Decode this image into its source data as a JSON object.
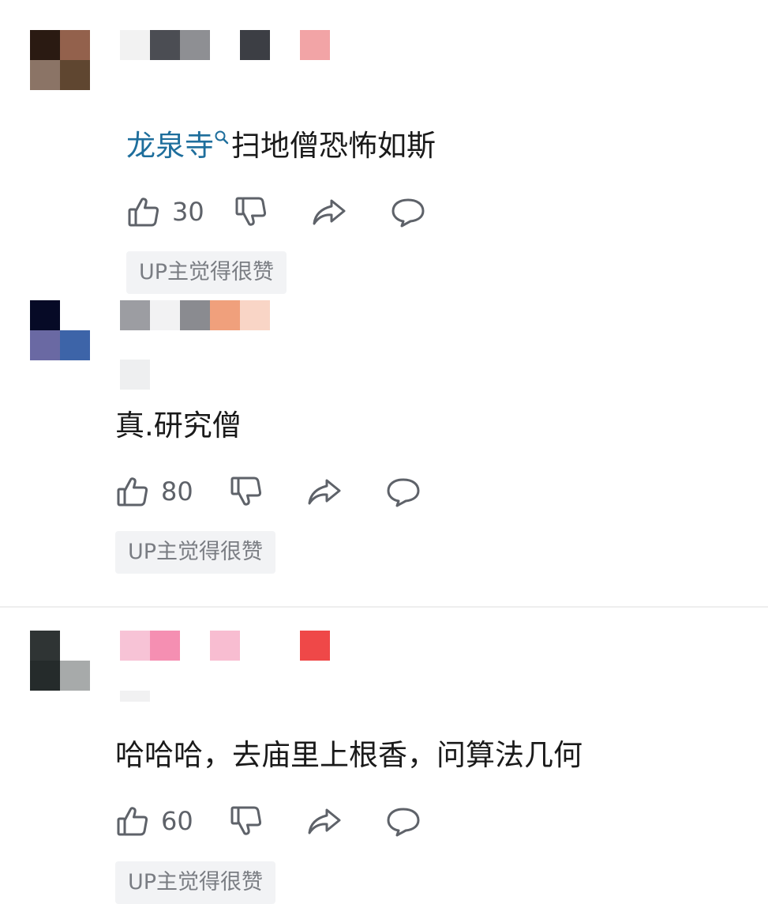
{
  "comments": [
    {
      "keyword": "龙泉寺",
      "text": "扫地僧恐怖如斯",
      "likes": "30",
      "badge": "UP主觉得很赞",
      "avatar_colors": [
        "#2a1a12",
        "#93614c",
        "#8b7466",
        "#5f4630"
      ],
      "name_blur_colors": [
        "#f2f2f2",
        "#4b4d53",
        "#8e8f93",
        "#ffffff",
        "#3c3e44",
        "#ffffff",
        "#f2a4a6"
      ]
    },
    {
      "text": "真.研究僧",
      "likes": "80",
      "badge": "UP主觉得很赞",
      "avatar_colors": [
        "#060a26",
        "#ffffff",
        "#6a69a3",
        "#3d64a8"
      ],
      "name_blur_colors": [
        "#9c9da2",
        "#f2f2f3",
        "#8a8b90",
        "#f0a07c",
        "#f9d5c6"
      ]
    },
    {
      "text": "哈哈哈，去庙里上根香，问算法几何",
      "likes": "60",
      "badge": "UP主觉得很赞",
      "avatar_colors": [
        "#2f3434",
        "#ffffff",
        "#252b2b",
        "#a7aaaa"
      ],
      "name_blur_colors": [
        "#f7c3d6",
        "#f58fb2",
        "#ffffff",
        "#f8bdd1",
        "#ffffff",
        "#ffffff",
        "#ef4848"
      ]
    }
  ],
  "colors": {
    "keyword_link": "#1e6e9c",
    "icon_stroke": "#5e6269",
    "badge_bg": "#f2f3f5",
    "badge_text": "#7a7d83"
  },
  "icons": [
    "thumbs-up-icon",
    "thumbs-down-icon",
    "share-icon",
    "reply-icon",
    "search-icon"
  ]
}
